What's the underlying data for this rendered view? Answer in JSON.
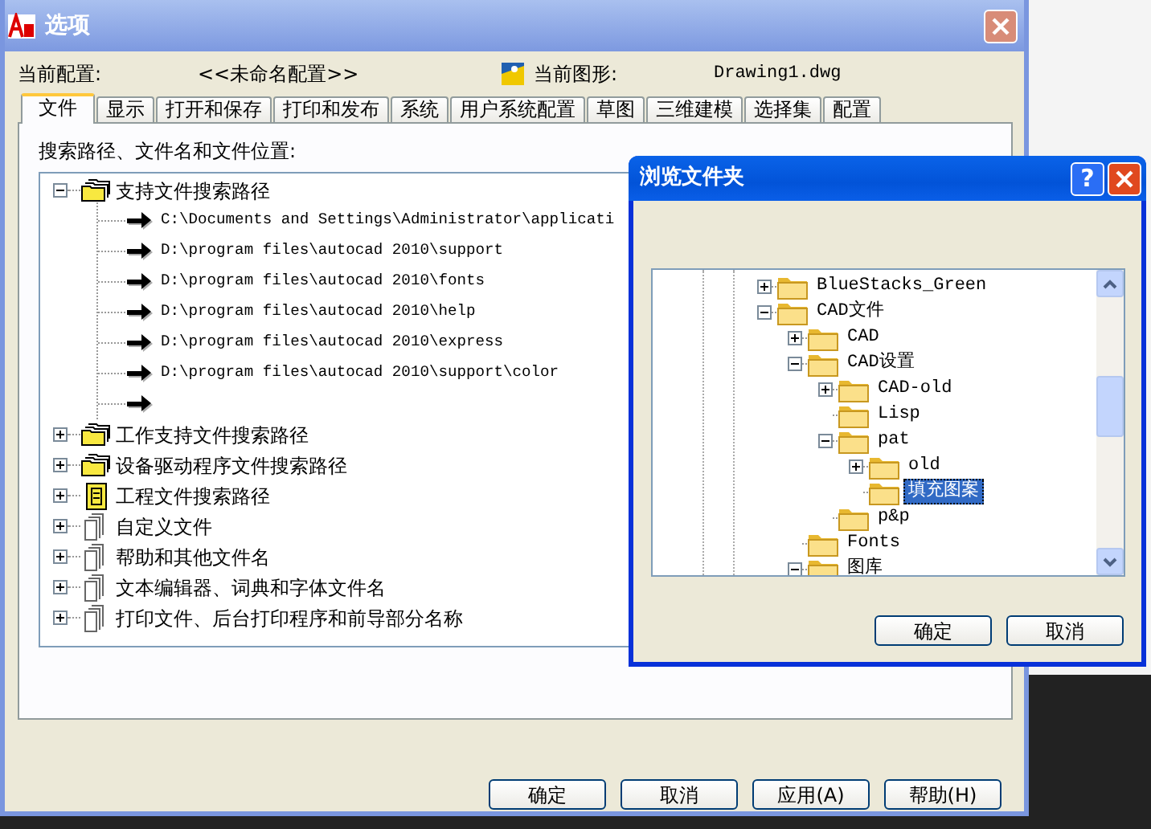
{
  "window": {
    "title": "选项"
  },
  "profile": {
    "label": "当前配置:",
    "value": "<<未命名配置>>"
  },
  "drawing": {
    "label": "当前图形:",
    "value": "Drawing1.dwg"
  },
  "tabs": [
    {
      "label": "文件",
      "selected": true
    },
    {
      "label": "显示",
      "selected": false
    },
    {
      "label": "打开和保存",
      "selected": false
    },
    {
      "label": "打印和发布",
      "selected": false
    },
    {
      "label": "系统",
      "selected": false
    },
    {
      "label": "用户系统配置",
      "selected": false
    },
    {
      "label": "草图",
      "selected": false
    },
    {
      "label": "三维建模",
      "selected": false
    },
    {
      "label": "选择集",
      "selected": false
    },
    {
      "label": "配置",
      "selected": false
    }
  ],
  "panel_label": "搜索路径、文件名和文件位置:",
  "tree": [
    {
      "label": "支持文件搜索路径",
      "kind": "folders",
      "expanded": true,
      "children": [
        {
          "kind": "path",
          "label": "C:\\Documents and Settings\\Administrator\\applicati"
        },
        {
          "kind": "path",
          "label": "D:\\program files\\autocad 2010\\support"
        },
        {
          "kind": "path",
          "label": "D:\\program files\\autocad 2010\\fonts"
        },
        {
          "kind": "path",
          "label": "D:\\program files\\autocad 2010\\help"
        },
        {
          "kind": "path",
          "label": "D:\\program files\\autocad 2010\\express"
        },
        {
          "kind": "path",
          "label": "D:\\program files\\autocad 2010\\support\\color"
        },
        {
          "kind": "new"
        }
      ]
    },
    {
      "label": "工作支持文件搜索路径",
      "kind": "folders",
      "expanded": false
    },
    {
      "label": "设备驱动程序文件搜索路径",
      "kind": "folders",
      "expanded": false
    },
    {
      "label": "工程文件搜索路径",
      "kind": "project",
      "expanded": false
    },
    {
      "label": "自定义文件",
      "kind": "file",
      "expanded": false
    },
    {
      "label": "帮助和其他文件名",
      "kind": "file",
      "expanded": false
    },
    {
      "label": "文本编辑器、词典和字体文件名",
      "kind": "file",
      "expanded": false
    },
    {
      "label": "打印文件、后台打印程序和前导部分名称",
      "kind": "file",
      "expanded": false
    }
  ],
  "buttons": [
    {
      "label": "确定"
    },
    {
      "label": "取消"
    },
    {
      "label": "应用(A)"
    },
    {
      "label": "帮助(H)"
    }
  ],
  "dialog": {
    "title": "浏览文件夹",
    "help_button": "?",
    "tree": [
      {
        "label": "BlueStacks_Green",
        "expanded": false,
        "selected": false
      },
      {
        "label": "CAD文件",
        "expanded": true,
        "selected": false,
        "children": [
          {
            "label": "CAD",
            "expanded": false,
            "selected": false
          },
          {
            "label": "CAD设置",
            "expanded": true,
            "selected": false,
            "children": [
              {
                "label": "CAD-old",
                "expanded": false,
                "selected": false
              },
              {
                "label": "Lisp",
                "selected": false
              },
              {
                "label": "pat",
                "expanded": true,
                "selected": false,
                "children": [
                  {
                    "label": "old",
                    "expanded": false,
                    "selected": false
                  },
                  {
                    "label": "填充图案",
                    "selected": true
                  }
                ]
              },
              {
                "label": "p&p",
                "selected": false
              }
            ]
          },
          {
            "label": "Fonts",
            "selected": false
          },
          {
            "label": "图库",
            "expanded": true,
            "selected": false
          }
        ]
      }
    ],
    "buttons": [
      {
        "label": "确定"
      },
      {
        "label": "取消"
      }
    ]
  }
}
